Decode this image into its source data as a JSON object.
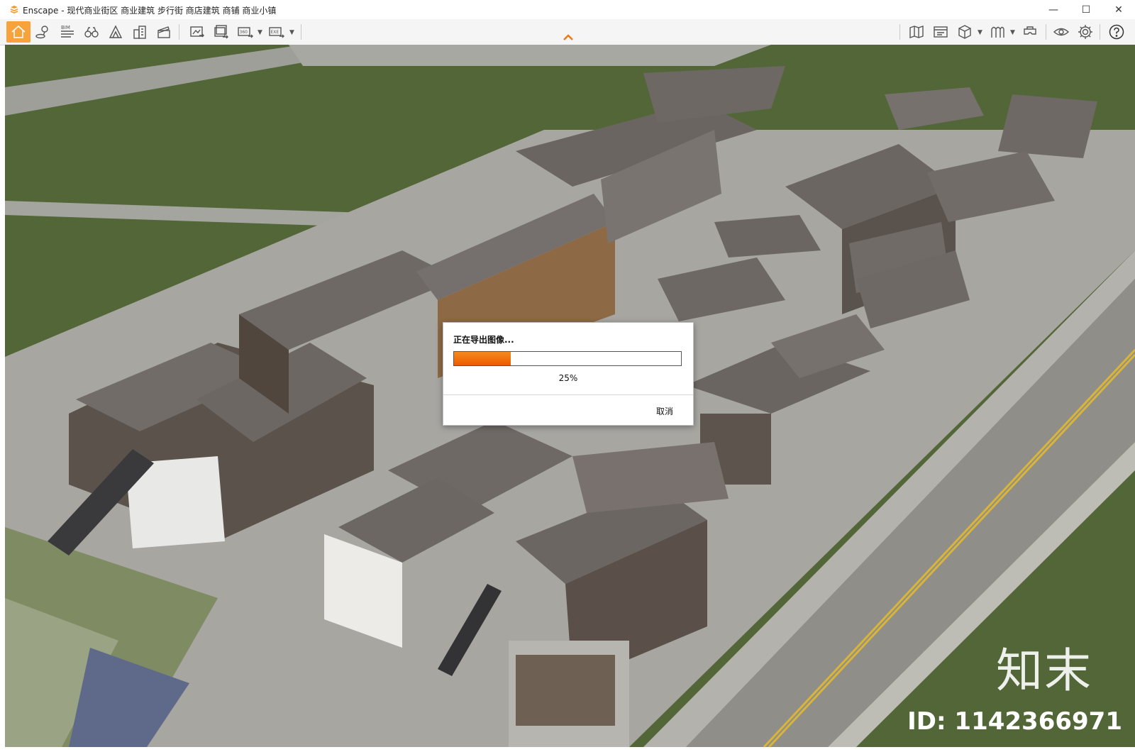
{
  "window": {
    "title": "Enscape - 现代商业街区 商业建筑 步行街 商店建筑 商铺 商业小镇",
    "minimize": "—",
    "maximize": "☐",
    "close": "✕"
  },
  "toolbar": {
    "left": [
      {
        "name": "home-icon"
      },
      {
        "name": "location-pin-icon"
      },
      {
        "name": "bim-icon",
        "label": "BIM"
      },
      {
        "name": "binoculars-icon"
      },
      {
        "name": "scene-icon"
      },
      {
        "name": "buildings-icon"
      },
      {
        "name": "clapper-icon"
      },
      {
        "name": "screenshot-export-icon"
      },
      {
        "name": "batch-export-icon"
      },
      {
        "name": "panorama-360-icon",
        "label": "360°"
      },
      {
        "name": "exe-export-icon",
        "label": "EXE"
      }
    ],
    "right": [
      {
        "name": "map-icon"
      },
      {
        "name": "video-editor-icon"
      },
      {
        "name": "cube-icon"
      },
      {
        "name": "library-icon"
      },
      {
        "name": "vr-headset-icon"
      },
      {
        "name": "eye-icon"
      },
      {
        "name": "settings-gear-icon"
      },
      {
        "name": "help-icon"
      }
    ]
  },
  "dialog": {
    "title": "正在导出图像...",
    "progress": 0.25,
    "percent_label": "25%",
    "cancel_label": "取消"
  },
  "watermark": {
    "logo": "知末",
    "id_label": "ID: 1142366971"
  },
  "colors": {
    "accent": "#f7a23a",
    "progress": "#f07010",
    "grass": "#4e6333",
    "roof": "#6d6764",
    "paving": "#a7a6a1"
  }
}
